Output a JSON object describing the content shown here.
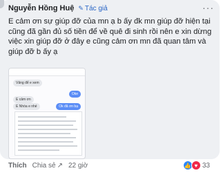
{
  "comment": {
    "author": "Nguyễn Hồng Huệ",
    "role": "Tác giả",
    "text": "E cảm ơn sự giúp đỡ của mn ạ b ấy đk mn giúp đỡ hiện tại cũng đã gần đủ số tiền để về quê đi sinh rồi nên e xin dừng việc xin giúp đỡ ở đây e cũng cảm ơn mn đã quan tâm và giúp đỡ b ấy ạ",
    "more_label": "···"
  },
  "attachment": {
    "messages": [
      "Vâng để e xem",
      "Oke",
      "E cảm ơn",
      "E Nhóa e nhé",
      "Ok đã ơn bạ"
    ]
  },
  "footer": {
    "like": "Thích",
    "share": "Chia sẻ",
    "time": "22 giờ",
    "reaction_count": "33"
  },
  "colors": {
    "role_blue": "#2a66c6",
    "like_blue": "#2d88ff",
    "love_red": "#f0284a"
  }
}
